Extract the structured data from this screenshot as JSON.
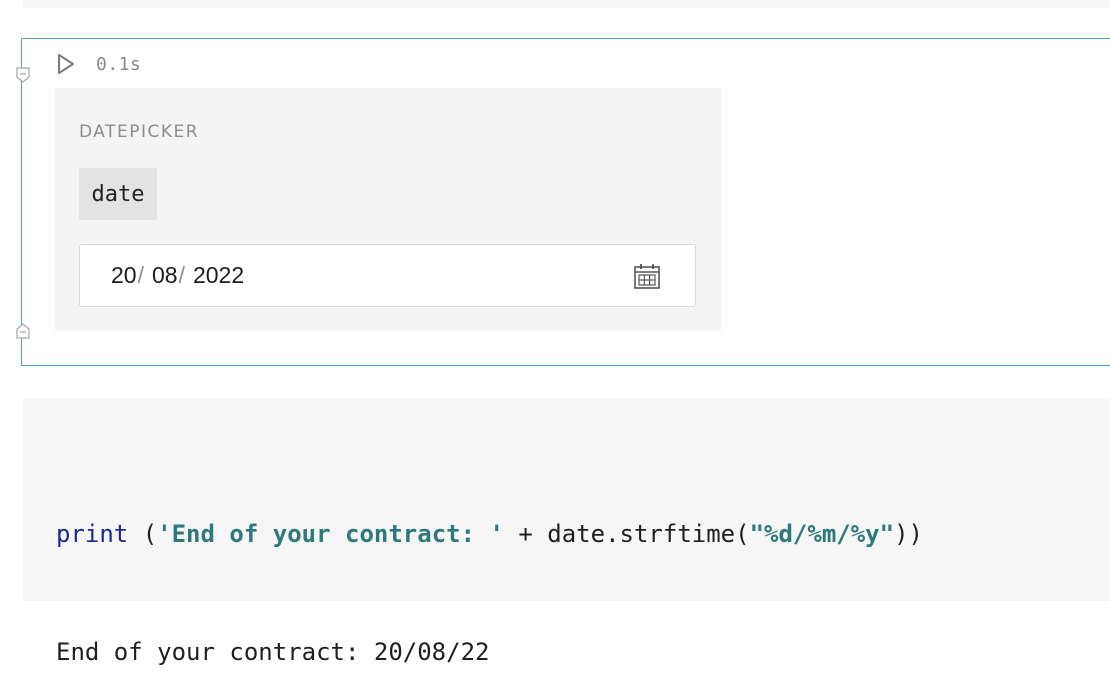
{
  "top_cell": {},
  "widget_cell": {
    "exec_time": "0.1s",
    "widget": {
      "title": "DATEPICKER",
      "variable_name": "date",
      "date_input": {
        "day": "20",
        "month": "08",
        "year": "2022",
        "separator": "/",
        "calendar_icon": "calendar-icon"
      }
    },
    "icons": {
      "run": "play-triangle-icon",
      "fold_top": "fold-collapse-icon",
      "fold_bottom": "fold-collapse-icon"
    },
    "border_color": "#5b9bd1"
  },
  "code_cell": {
    "code": {
      "func": "print",
      "open": " (",
      "str1": "'End of your contract: '",
      "mid": " + date.strftime(",
      "str2": "\"%d/%m/%y\"",
      "close": "))"
    }
  },
  "output": {
    "text": "End of your contract: 20/08/22"
  }
}
